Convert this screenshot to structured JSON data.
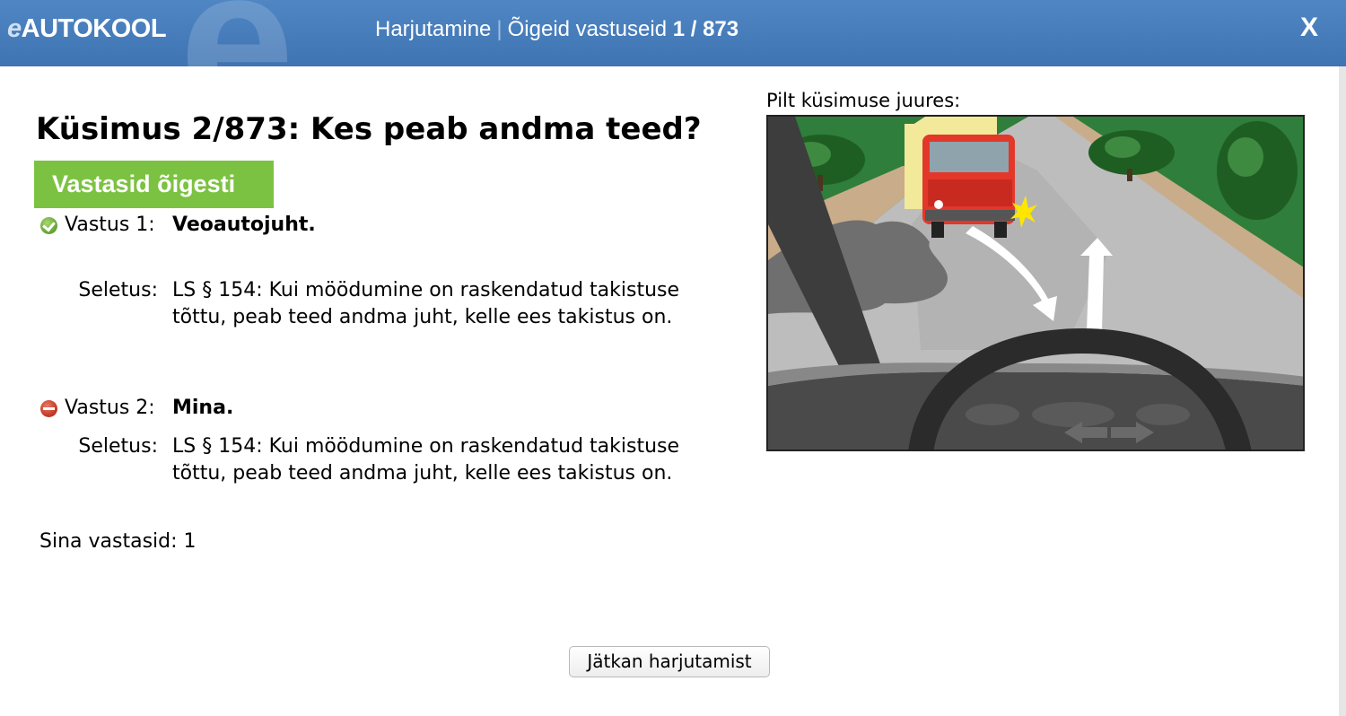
{
  "header": {
    "logo_prefix": "e",
    "logo_text": "AUTOKOOL",
    "mode": "Harjutamine",
    "separator": "|",
    "correct_label": "Õigeid vastuseid",
    "correct_count": "1 / 873",
    "close_label": "X"
  },
  "question": {
    "title": "Küsimus 2/873: Kes peab andma teed?",
    "result": "Vastasid õigesti"
  },
  "answers": [
    {
      "status": "correct",
      "icon": "check-circle-icon",
      "label": "Vastus 1:",
      "text": "Veoautojuht.",
      "explanation_label": "Seletus:",
      "explanation": "LS § 154: Kui möödumine on raskendatud takistuse tõttu, peab teed andma juht, kelle ees takistus on."
    },
    {
      "status": "wrong",
      "icon": "minus-circle-icon",
      "label": "Vastus 2:",
      "text": "Mina.",
      "explanation_label": "Seletus:",
      "explanation": "LS § 154: Kui möödumine on raskendatud takistuse tõttu, peab teed andma juht, kelle ees takistus on."
    }
  ],
  "your_answer": "Sina vastasid: 1",
  "picture": {
    "label": "Pilt küsimuse juures:"
  },
  "continue_button": "Jätkan harjutamist",
  "colors": {
    "header_bg": "#4a80bf",
    "result_green": "#7cc242",
    "road": "#b9b9b9",
    "grass": "#2e7d3a",
    "truck_red": "#e23a2c"
  }
}
